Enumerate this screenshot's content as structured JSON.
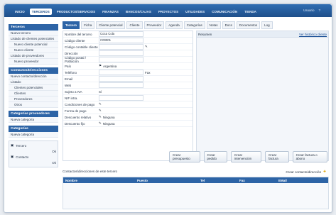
{
  "colors": {
    "accent": "#2d64a6",
    "topbar": "#1f4f8a"
  },
  "nav": {
    "tabs": [
      "INICIO",
      "TERCEROS",
      "PRODUCTOS/SERVICIOS",
      "FINANZAS",
      "BANCOS/CAJAS",
      "PROYECTOS",
      "UTILIDADES",
      "COMUNICACIÓN",
      "TIENDA"
    ],
    "user": "Usuario",
    "help": "?"
  },
  "sidebar": {
    "terceros_title": "Terceros",
    "terceros_items": [
      "Nuevo tercero",
      "Listado de clientes potenciales",
      "Nuevo cliente potencial",
      "Nuevo cliente",
      "Listado de proveedores",
      "Nuevo proveedor"
    ],
    "contactos_title": "Contactos/Direcciones",
    "contactos_items": [
      "Nuevo contacto/dirección",
      "Listado",
      "Clientes potenciales",
      "Clientes",
      "Proveedores",
      "Otros"
    ],
    "cat_prov_title": "Categorías proveedores",
    "cat_prov_items": [
      "Nueva categoría"
    ],
    "cat_title": "Categorías",
    "cat_items": [
      "Nueva categoría"
    ],
    "mini": [
      {
        "label": "Tercero",
        "extra": "Ok"
      },
      {
        "label": "Contacto",
        "extra": "Ok"
      }
    ]
  },
  "subtabs": [
    "Tercero",
    "Ficha",
    "Cliente potencial",
    "Cliente",
    "Proveedor",
    "Agenda",
    "Categorías",
    "Notas",
    "Docs",
    "Documentos",
    "Log"
  ],
  "form": {
    "rows": [
      {
        "label": "Nombre del tercero",
        "value": "Coca Cola"
      },
      {
        "label": "Código cliente",
        "value": "C00001"
      },
      {
        "label": "Código contable cliente",
        "value": ""
      },
      {
        "label": "Dirección",
        "value": ""
      },
      {
        "label": "Código postal / Población",
        "value": ""
      },
      {
        "label": "País",
        "value": "Argentina"
      },
      {
        "label": "Teléfono",
        "value": "",
        "extra": "Fax"
      },
      {
        "label": "Email",
        "value": ""
      },
      {
        "label": "Web",
        "value": ""
      },
      {
        "label": "Sujeto a IVA",
        "value": "Sí"
      },
      {
        "label": "NIF intra.",
        "value": ""
      },
      {
        "label": "Condiciones de pago",
        "value": ""
      },
      {
        "label": "Forma de pago",
        "value": ""
      },
      {
        "label": "Descuento relativo",
        "value": "Ninguna"
      },
      {
        "label": "Descuento fijo",
        "value": "Ninguna"
      }
    ]
  },
  "observ": {
    "title": "Resumen",
    "link": "Ver histórico cliente"
  },
  "actions": [
    "Crear presupuesto",
    "Crear pedido",
    "Crear intervención",
    "Crear factura",
    "Crear factura o abono"
  ],
  "contacts": {
    "title": "Contactos/direcciones de este tercero",
    "new": "Crear contacto/dirección",
    "columns": [
      "Nombre",
      "Puesto",
      "Tel",
      "Fax",
      "EMail"
    ]
  }
}
